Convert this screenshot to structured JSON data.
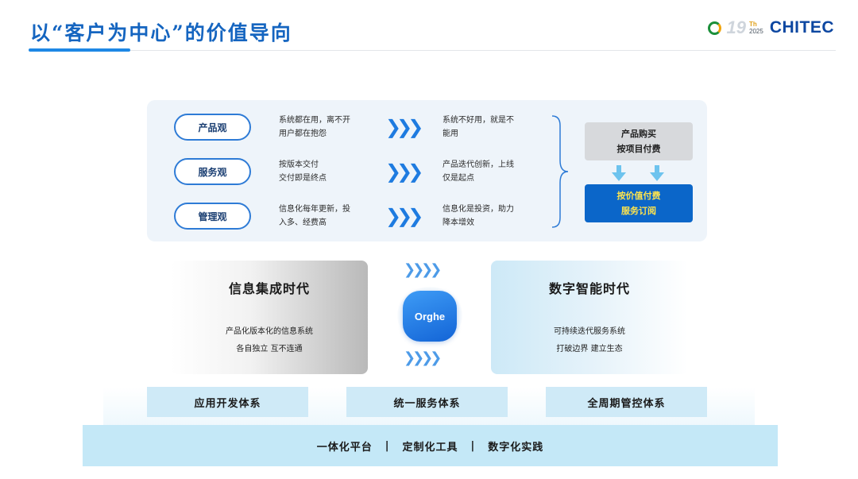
{
  "header": {
    "title": "以“客户为中心”的价值导向",
    "logo": {
      "number": "19",
      "sup_th": "Th",
      "sup_year": "2025",
      "text": "CHITEC"
    }
  },
  "views": [
    {
      "label": "产品观",
      "old_line1": "系统都在用，离不开",
      "old_line2": "用户都在抱怨",
      "new_line1": "系统不好用，就是不",
      "new_line2": "能用"
    },
    {
      "label": "服务观",
      "old_line1": "按版本交付",
      "old_line2": "交付即是终点",
      "new_line1": "产品迭代创新，上线",
      "new_line2": "仅是起点"
    },
    {
      "label": "管理观",
      "old_line1": "信息化每年更新，投",
      "old_line2": "入多、经费高",
      "new_line1": "信息化是投资，助力",
      "new_line2": "降本增效"
    }
  ],
  "arrow_glyph": "❯❯❯",
  "payment": {
    "old_line1": "产品购买",
    "old_line2": "按项目付费",
    "new_line1": "按价值付费",
    "new_line2": "服务订阅"
  },
  "eras": {
    "left": {
      "title": "信息集成时代",
      "line1": "产品化版本化的信息系统",
      "line2": "各自独立 互不连通"
    },
    "right": {
      "title": "数字智能时代",
      "line1": "可持续迭代服务系统",
      "line2": "打破边界 建立生态"
    }
  },
  "center": {
    "app_name": "Orghe",
    "arrows": "❯❯❯❯"
  },
  "systems": [
    "应用开发体系",
    "统一服务体系",
    "全周期管控体系"
  ],
  "platform": {
    "items": [
      "一体化平台",
      "定制化工具",
      "数字化实践"
    ],
    "separator": "|"
  },
  "colors": {
    "primary": "#1565c0",
    "accent_blue": "#0b66c9",
    "highlight_yellow": "#ffe44d",
    "light_cyan": "#c4e8f7"
  }
}
